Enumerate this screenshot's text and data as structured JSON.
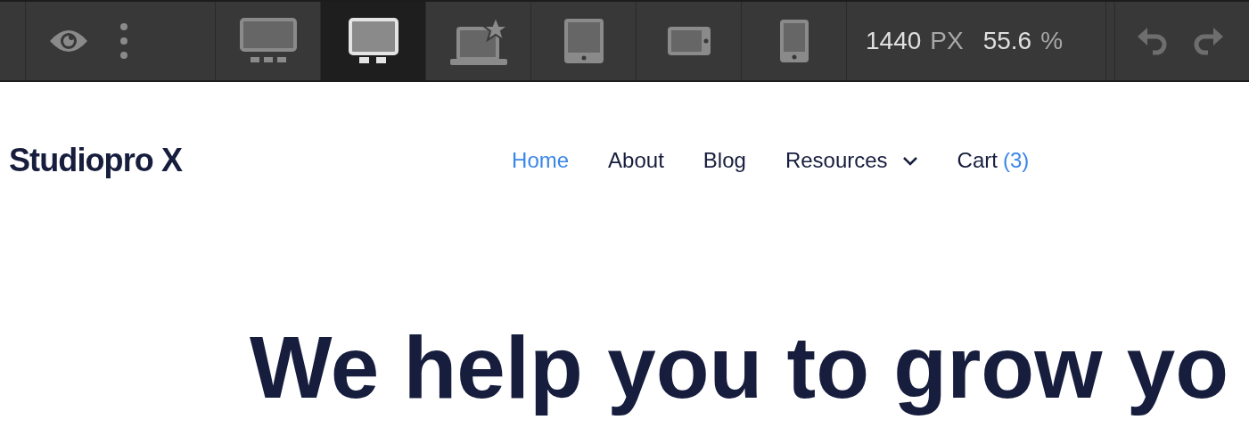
{
  "toolbar": {
    "devices": [
      {
        "kind": "desktop-wide",
        "selected": false
      },
      {
        "kind": "desktop",
        "selected": true
      },
      {
        "kind": "laptop-star",
        "selected": false
      },
      {
        "kind": "tablet",
        "selected": false
      },
      {
        "kind": "tablet-landscape",
        "selected": false
      },
      {
        "kind": "phone",
        "selected": false
      }
    ],
    "width_value": "1440",
    "width_unit": "PX",
    "zoom_value": "55.6",
    "zoom_unit": "%"
  },
  "site": {
    "logo": "Studiopro X",
    "nav": [
      {
        "label": "Home",
        "selected": true
      },
      {
        "label": "About",
        "selected": false
      },
      {
        "label": "Blog",
        "selected": false
      },
      {
        "label": "Resources",
        "selected": false,
        "dropdown": true
      },
      {
        "label": "Cart",
        "selected": false,
        "count": "(3)"
      }
    ],
    "heading": "We help you to grow yo"
  }
}
